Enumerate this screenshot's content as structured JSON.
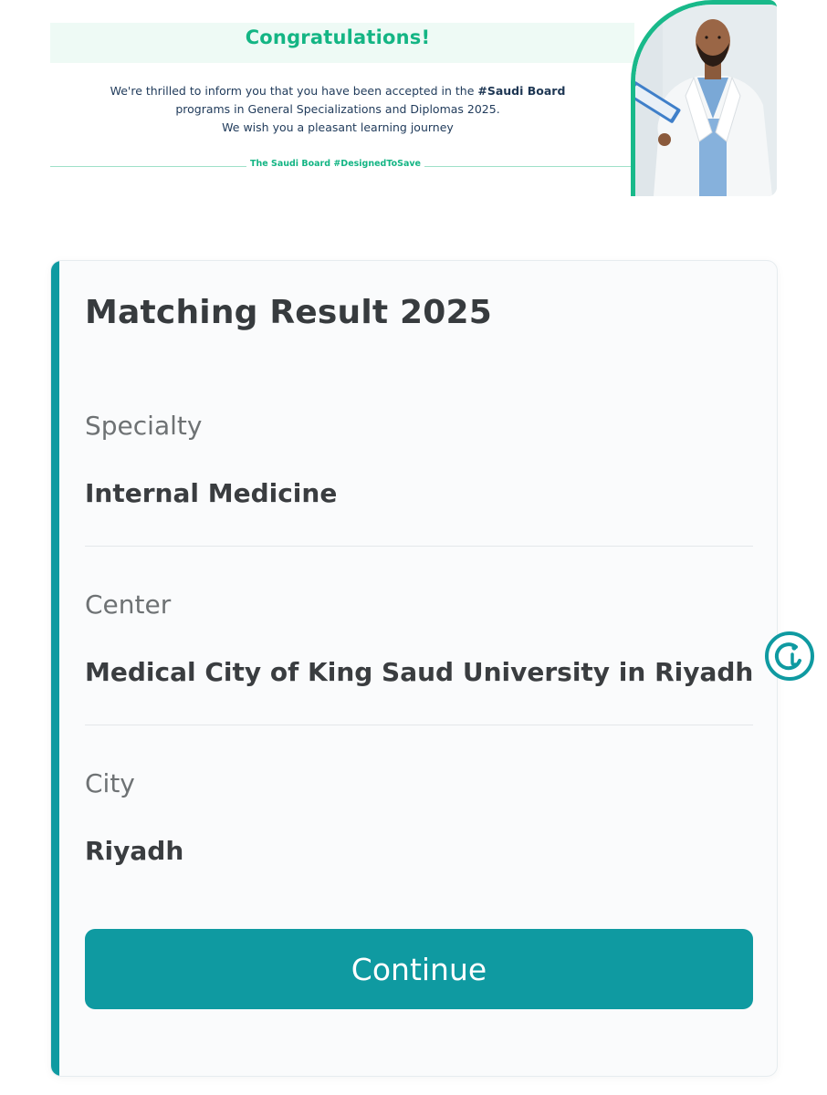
{
  "banner": {
    "title": "Congratulations!",
    "message_line1_pre": "We're thrilled to inform you that you have been accepted in the ",
    "message_line1_bold": "#Saudi Board",
    "message_line2": "programs in General Specializations and Diplomas 2025.",
    "message_line3": "We wish you a pleasant learning journey",
    "tagline": "The Saudi Board #DesignedToSave"
  },
  "card": {
    "title": "Matching Result 2025",
    "fields": [
      {
        "label": "Specialty",
        "value": "Internal Medicine"
      },
      {
        "label": "Center",
        "value": "Medical City of King Saud University in Riyadh"
      },
      {
        "label": "City",
        "value": "Riyadh"
      }
    ],
    "continue_label": "Continue"
  },
  "colors": {
    "accent": "#0f9aa1",
    "banner_green": "#14b584",
    "banner_text": "#1f3a5a"
  },
  "icons": {
    "help": "chat-help-icon"
  }
}
